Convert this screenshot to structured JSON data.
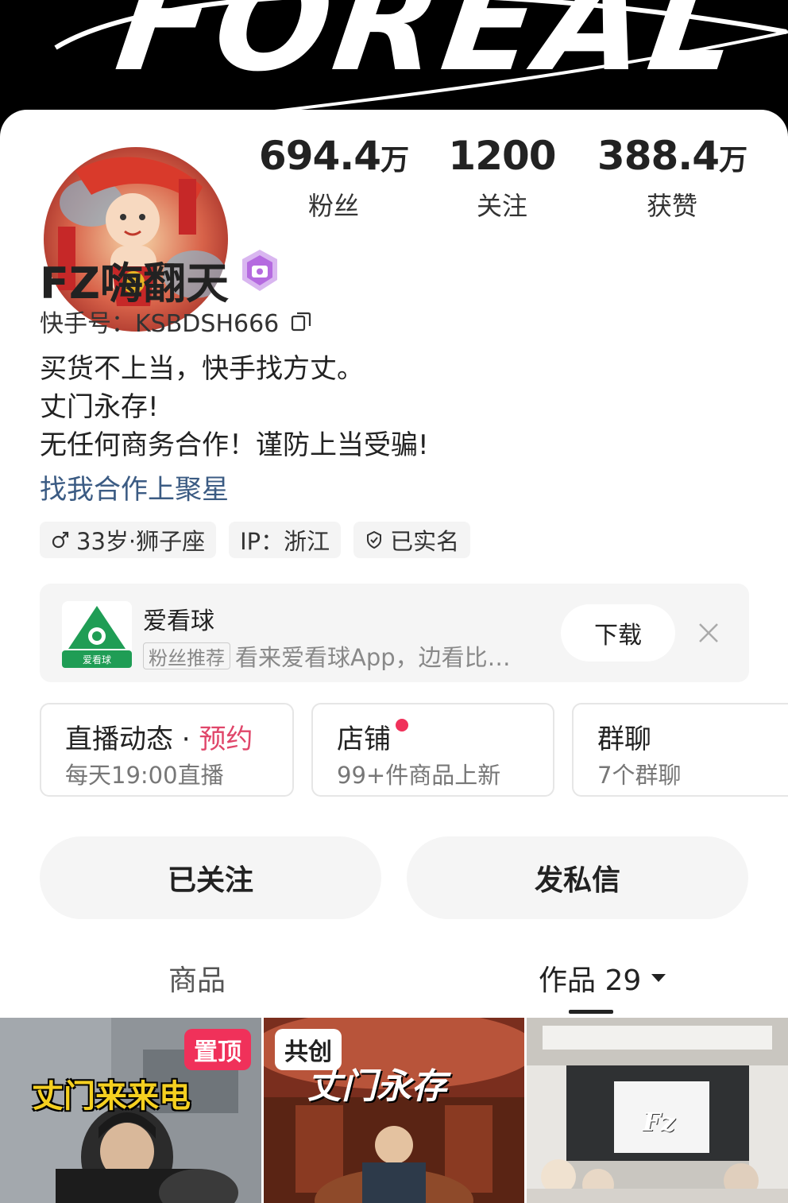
{
  "banner": {
    "text": "FOREAL"
  },
  "profile": {
    "name": "FZ嗨翻天",
    "kuaishou_id": "快手号：KSBDSH666",
    "bio_lines": [
      "买货不上当，快手找方丈。",
      "丈门永存!",
      "无任何商务合作！谨防上当受骗!"
    ],
    "bio_link": "找我合作上聚星",
    "tags": {
      "age_sign": "33岁·狮子座",
      "ip": "IP：浙江",
      "verified": "已实名"
    },
    "icons": {
      "badge": "verified-creator-badge-icon",
      "copy": "copy-icon",
      "gender": "male-icon",
      "shield": "shield-check-icon"
    }
  },
  "stats": [
    {
      "value": "694.4",
      "unit": "万",
      "label": "粉丝"
    },
    {
      "value": "1200",
      "unit": "",
      "label": "关注"
    },
    {
      "value": "388.4",
      "unit": "万",
      "label": "获赞"
    }
  ],
  "ad": {
    "app_name": "爱看球",
    "logo_text": "爱看球",
    "tag": "粉丝推荐",
    "description": "看来爱看球App，边看比…",
    "download_label": "下载",
    "close_icon": "close-icon"
  },
  "features": {
    "live": {
      "title": "直播动态",
      "separator": " · ",
      "accent": "预约",
      "subtitle": "每天19:00直播"
    },
    "shop": {
      "title": "店铺",
      "subtitle": "99+件商品上新"
    },
    "group": {
      "title": "群聊",
      "subtitle": "7个群聊"
    }
  },
  "actions": {
    "following": "已关注",
    "message": "发私信"
  },
  "tabs": {
    "products": "商品",
    "works": "作品 29",
    "works_icon": "caret-down-icon"
  },
  "grid": [
    {
      "badge": "置顶",
      "caption": "丈门来来电"
    },
    {
      "badge": "共创",
      "caption": "丈门永存"
    },
    {
      "badge": "",
      "caption": "Fz"
    }
  ],
  "colors": {
    "accent": "#e0466a",
    "pin_badge": "#f0315a",
    "link": "#3b5b83"
  }
}
